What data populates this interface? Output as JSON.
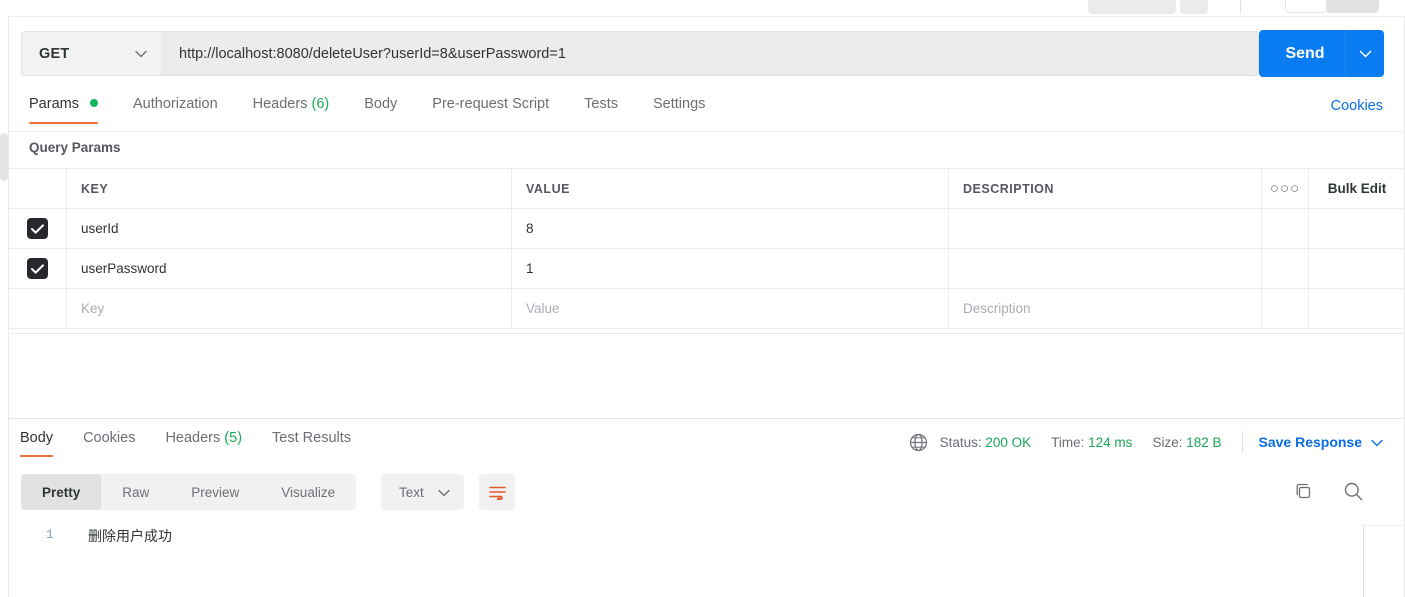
{
  "request": {
    "method": "GET",
    "method_caret_icon": "chevron-down-icon",
    "url": "http://localhost:8080/deleteUser?userId=8&userPassword=1",
    "send_label": "Send",
    "send_caret_icon": "chevron-down-icon",
    "tabs": [
      {
        "label": "Params",
        "dot": true,
        "active": true
      },
      {
        "label": "Authorization",
        "dot": false,
        "active": false
      },
      {
        "label": "Headers",
        "count": "(6)",
        "dot": false,
        "active": false
      },
      {
        "label": "Body",
        "dot": false,
        "active": false
      },
      {
        "label": "Pre-request Script",
        "dot": false,
        "active": false
      },
      {
        "label": "Tests",
        "dot": false,
        "active": false
      },
      {
        "label": "Settings",
        "dot": false,
        "active": false
      }
    ],
    "cookies_link": "Cookies"
  },
  "query_params": {
    "section_title": "Query Params",
    "columns": {
      "key": "KEY",
      "value": "VALUE",
      "description": "DESCRIPTION"
    },
    "options_icon": "ellipsis-icon",
    "options_glyph": "○○○",
    "bulk_edit_label": "Bulk Edit",
    "rows": [
      {
        "checked": true,
        "key": "userId",
        "value": "8",
        "description": ""
      },
      {
        "checked": true,
        "key": "userPassword",
        "value": "1",
        "description": ""
      }
    ],
    "placeholder_row": {
      "key": "Key",
      "value": "Value",
      "description": "Description"
    }
  },
  "response": {
    "tabs": [
      {
        "label": "Body",
        "active": true
      },
      {
        "label": "Cookies",
        "active": false
      },
      {
        "label": "Headers",
        "count": "(5)",
        "active": false
      },
      {
        "label": "Test Results",
        "active": false
      }
    ],
    "network_icon": "globe-icon",
    "status_label": "Status:",
    "status_value": "200 OK",
    "time_label": "Time:",
    "time_value": "124 ms",
    "size_label": "Size:",
    "size_value": "182 B",
    "save_response_label": "Save Response",
    "save_response_caret_icon": "chevron-down-icon",
    "view_modes": [
      {
        "label": "Pretty",
        "active": true
      },
      {
        "label": "Raw",
        "active": false
      },
      {
        "label": "Preview",
        "active": false
      },
      {
        "label": "Visualize",
        "active": false
      }
    ],
    "format_selected": "Text",
    "format_caret_icon": "chevron-down-icon",
    "wrap_lines_icon": "wrap-lines-icon",
    "copy_icon": "copy-icon",
    "search_icon": "search-icon",
    "body_lines": [
      {
        "number": "1",
        "text": "删除用户成功"
      }
    ]
  },
  "colors": {
    "accent_blue": "#0a7cf1",
    "tab_underline": "#ef6c3c",
    "status_green": "#17a85a",
    "dot_green": "#17b55c",
    "link_blue": "#0a6ee0"
  }
}
